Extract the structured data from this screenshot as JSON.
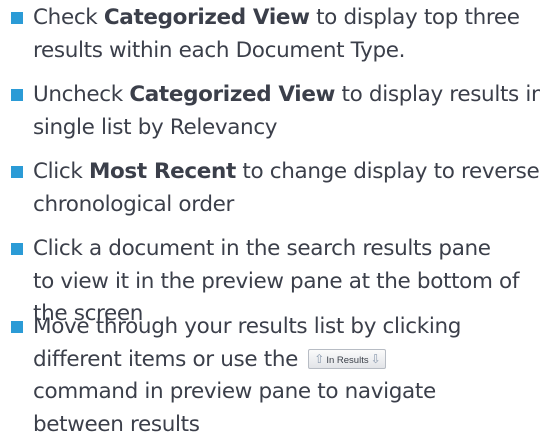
{
  "accent_color": "#2b9bd6",
  "bullets": [
    {
      "lines": [
        [
          "Check ",
          "Categorized View",
          " to display top three"
        ],
        [
          "results within each Document Type."
        ]
      ]
    },
    {
      "lines": [
        [
          "Uncheck ",
          "Categorized View",
          " to display results in"
        ],
        [
          "single list by Relevancy"
        ]
      ]
    },
    {
      "lines": [
        [
          "Click ",
          "Most Recent",
          " to change display to reverse"
        ],
        [
          "chronological order"
        ]
      ]
    },
    {
      "lines": [
        [
          "Click a document in the search results pane"
        ],
        [
          "to view it in the preview pane at the bottom of"
        ],
        [
          "the screen"
        ]
      ]
    },
    {
      "lines": [
        [
          "Move through your results list by clicking"
        ],
        [
          "different items or use the "
        ],
        [
          "command in preview pane to navigate"
        ],
        [
          "between results"
        ]
      ],
      "inline_button": {
        "label": "In Results",
        "left_icon": "up-arrow-icon",
        "right_icon": "down-arrow-icon"
      }
    }
  ]
}
